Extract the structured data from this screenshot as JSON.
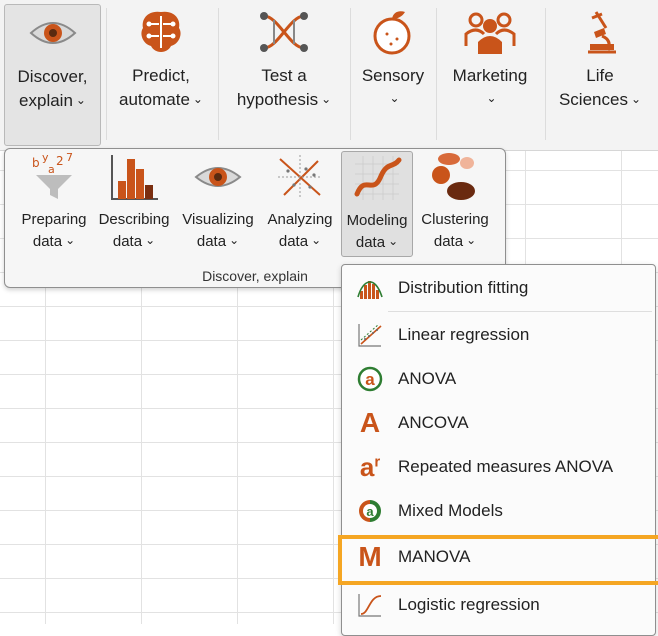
{
  "ribbon": {
    "buttons": [
      {
        "line1": "Discover,",
        "line2": "explain",
        "icon": "eye-icon"
      },
      {
        "line1": "Predict,",
        "line2": "automate",
        "icon": "brain-icon"
      },
      {
        "line1": "Test a",
        "line2": "hypothesis",
        "icon": "dna-icon"
      },
      {
        "line1": "Sensory",
        "line2": "",
        "icon": "orange-fruit-icon"
      },
      {
        "line1": "Marketing",
        "line2": "",
        "icon": "people-group-icon"
      },
      {
        "line1": "Life",
        "line2": "Sciences",
        "icon": "microscope-icon"
      }
    ]
  },
  "panel": {
    "group_label": "Discover, explain",
    "buttons": [
      {
        "line1": "Preparing",
        "line2": "data",
        "icon": "funnel-letters-icon"
      },
      {
        "line1": "Describing",
        "line2": "data",
        "icon": "histogram-icon"
      },
      {
        "line1": "Visualizing",
        "line2": "data",
        "icon": "eye-icon"
      },
      {
        "line1": "Analyzing",
        "line2": "data",
        "icon": "scatter-axes-icon"
      },
      {
        "line1": "Modeling",
        "line2": "data",
        "icon": "curve-fit-icon"
      },
      {
        "line1": "Clustering",
        "line2": "data",
        "icon": "clusters-icon"
      }
    ]
  },
  "menu": {
    "items": [
      {
        "label": "Distribution fitting",
        "icon": "distribution-icon"
      },
      {
        "label": "Linear regression",
        "icon": "regression-icon"
      },
      {
        "label": "ANOVA",
        "icon": "anova-icon"
      },
      {
        "label": "ANCOVA",
        "icon": "ancova-icon"
      },
      {
        "label": "Repeated measures ANOVA",
        "icon": "repeated-measures-icon"
      },
      {
        "label": "Mixed Models",
        "icon": "mixed-models-icon"
      },
      {
        "label": "MANOVA",
        "icon": "manova-icon"
      },
      {
        "label": "Logistic regression",
        "icon": "logistic-icon"
      }
    ],
    "highlighted": "MANOVA"
  },
  "colors": {
    "accent": "#c9541a",
    "highlight": "#f5a623"
  }
}
